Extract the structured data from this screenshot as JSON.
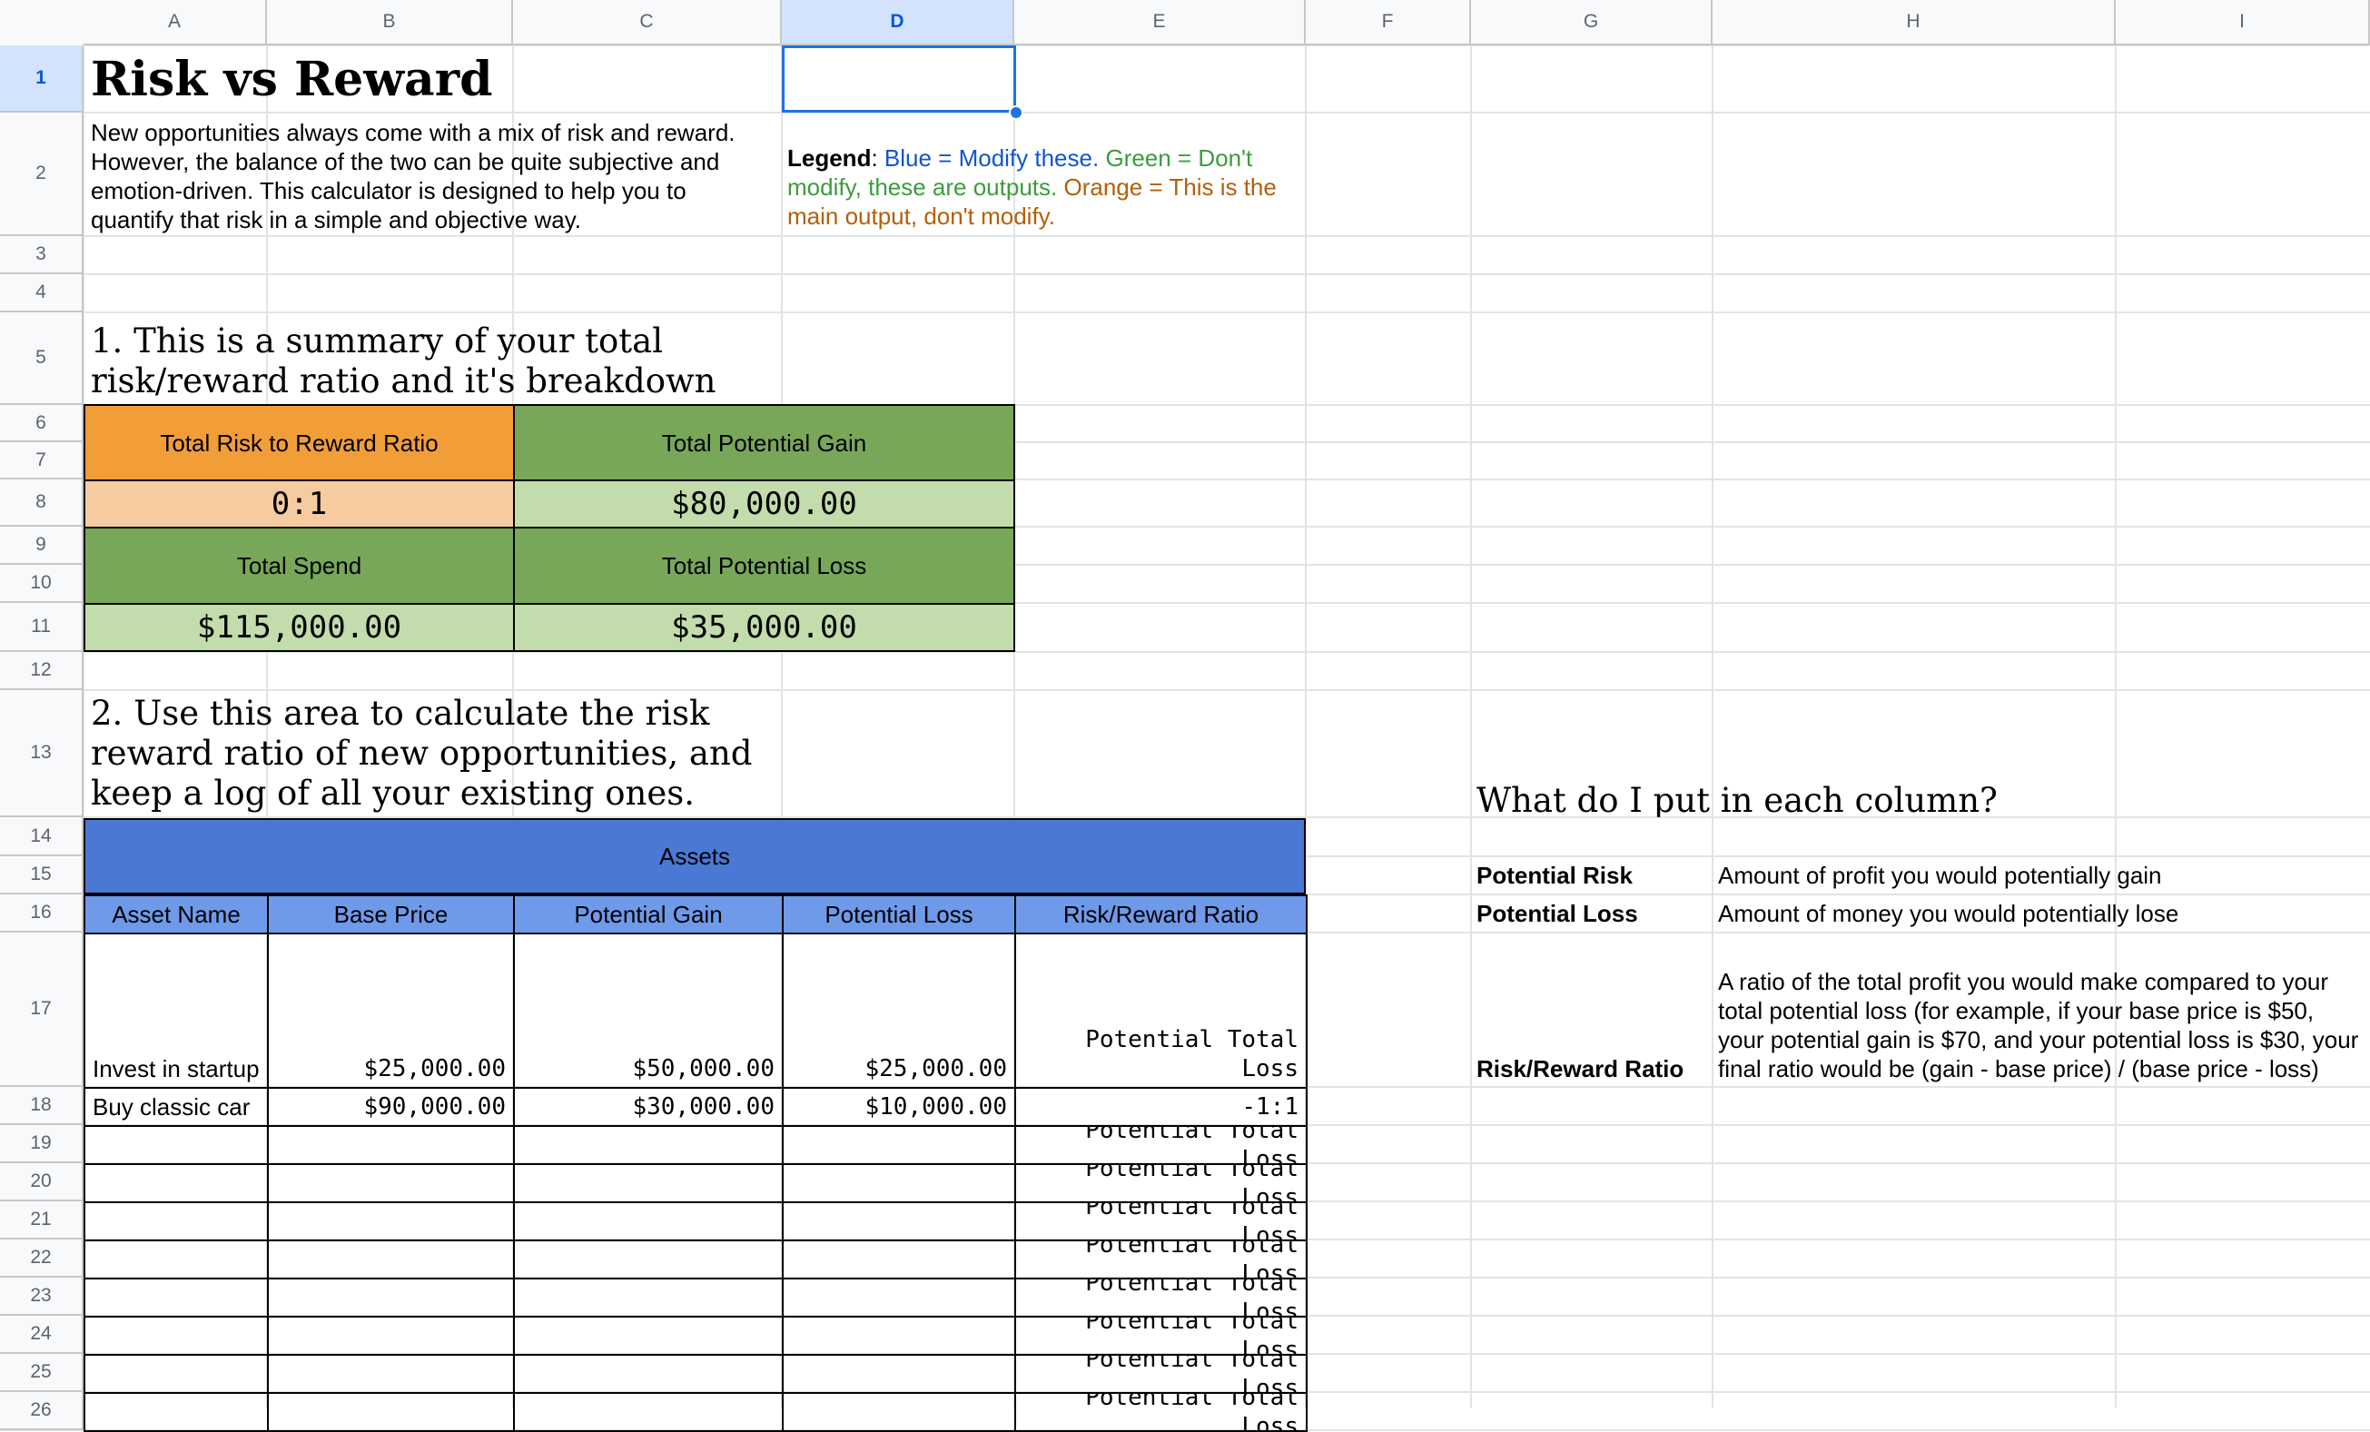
{
  "columns": [
    "A",
    "B",
    "C",
    "D",
    "E",
    "F",
    "G",
    "H",
    "I"
  ],
  "rows": [
    "1",
    "2",
    "3",
    "4",
    "5",
    "6",
    "7",
    "8",
    "9",
    "10",
    "11",
    "12",
    "13",
    "14",
    "15",
    "16",
    "17",
    "18",
    "19",
    "20",
    "21",
    "22",
    "23",
    "24",
    "25",
    "26"
  ],
  "selected_cell": "D1",
  "title": "Risk vs Reward",
  "intro": "New opportunities always come with a mix of risk and reward. However, the balance of the two can be quite subjective and emotion-driven. This calculator is designed to help you to quantify that risk in a simple and objective way.",
  "legend": {
    "label": "Legend",
    "sep": ": ",
    "blue": "Blue = Modify these.",
    "green": " Green = Don't modify, these are outputs.",
    "orange": " Orange = This is the main output, don't modify."
  },
  "section1_heading": "1. This is a summary of your total risk/reward ratio and it's breakdown",
  "summary": {
    "ratio_label": "Total Risk to Reward Ratio",
    "ratio_value": "0:1",
    "gain_label": "Total Potential Gain",
    "gain_value": "$80,000.00",
    "spend_label": "Total Spend",
    "spend_value": "$115,000.00",
    "loss_label": "Total Potential Loss",
    "loss_value": "$35,000.00"
  },
  "section2_heading": "2. Use this area to calculate the risk reward ratio of new opportunities, and keep a log of all your existing ones.",
  "assets": {
    "title": "Assets",
    "headers": [
      "Asset Name",
      "Base Price",
      "Potential Gain",
      "Potential Loss",
      "Risk/Reward Ratio"
    ],
    "rows": [
      {
        "name": "Invest in startup",
        "base": "$25,000.00",
        "gain": "$50,000.00",
        "loss": "$25,000.00",
        "ratio": "Potential Total Loss"
      },
      {
        "name": "Buy classic car",
        "base": "$90,000.00",
        "gain": "$30,000.00",
        "loss": "$10,000.00",
        "ratio": "-1:1"
      }
    ],
    "empty_ratio": "Potential Total Loss"
  },
  "help": {
    "heading": "What do I put in each column?",
    "items": [
      {
        "term": "Potential Risk",
        "desc": "Amount of profit you would potentially gain"
      },
      {
        "term": "Potential Loss",
        "desc": "Amount of money you would potentially lose"
      },
      {
        "term": "Risk/Reward Ratio",
        "desc": "A ratio of the total profit you would make compared to your total potential loss (for example, if your base price is $50, your potential gain is $70, and your potential loss is $30, your final ratio would be (gain - base price) / (base price - loss)"
      }
    ]
  },
  "colors": {
    "orange": "#f29e38",
    "orange_light": "#f7cba0",
    "green": "#78a75a",
    "green_light": "#c2dcab",
    "blue": "#4a78d4",
    "blue_light": "#6f9aea",
    "legend_blue": "#1155cc",
    "legend_green": "#3c9c3c",
    "legend_orange": "#b45f06"
  }
}
